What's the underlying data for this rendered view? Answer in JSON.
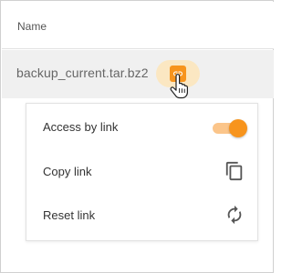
{
  "table": {
    "column_header": "Name",
    "row": {
      "file_name": "backup_current.tar.bz2"
    }
  },
  "link_menu": {
    "items": [
      {
        "label": "Access by link",
        "control": "toggle",
        "enabled": true
      },
      {
        "label": "Copy link",
        "icon": "copy-icon"
      },
      {
        "label": "Reset link",
        "icon": "refresh-icon"
      }
    ]
  },
  "colors": {
    "accent": "#f7941d",
    "accent_light": "#fbe7c2",
    "toggle_track": "#fbc58a",
    "row_highlight": "#f0f0f0"
  }
}
